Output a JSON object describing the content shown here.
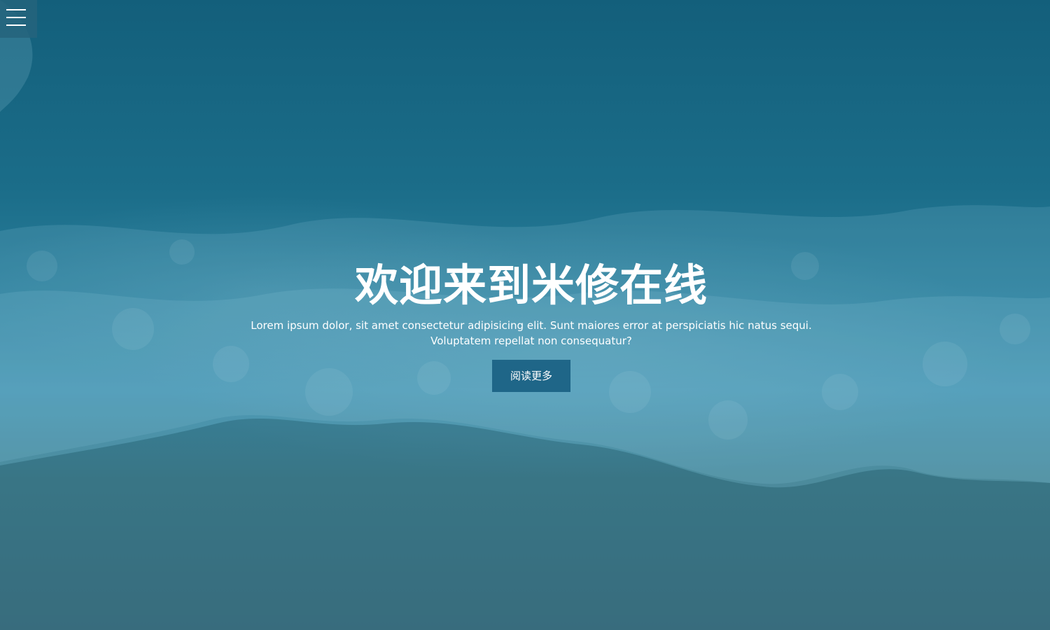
{
  "hero": {
    "title": "欢迎来到米修在线",
    "subtitle": "Lorem ipsum dolor, sit amet consectetur adipisicing elit. Sunt maiores error at perspiciatis hic natus sequi. Voluptatem repellat non consequatur?",
    "button_label": "阅读更多",
    "background_image": "ocean-waves-aerial"
  },
  "menu": {
    "icon": "hamburger-menu-icon"
  },
  "colors": {
    "overlay_top": "#135f7b",
    "overlay_bottom": "#3c7183",
    "button_bg": "#1f6688",
    "text": "#ffffff"
  }
}
